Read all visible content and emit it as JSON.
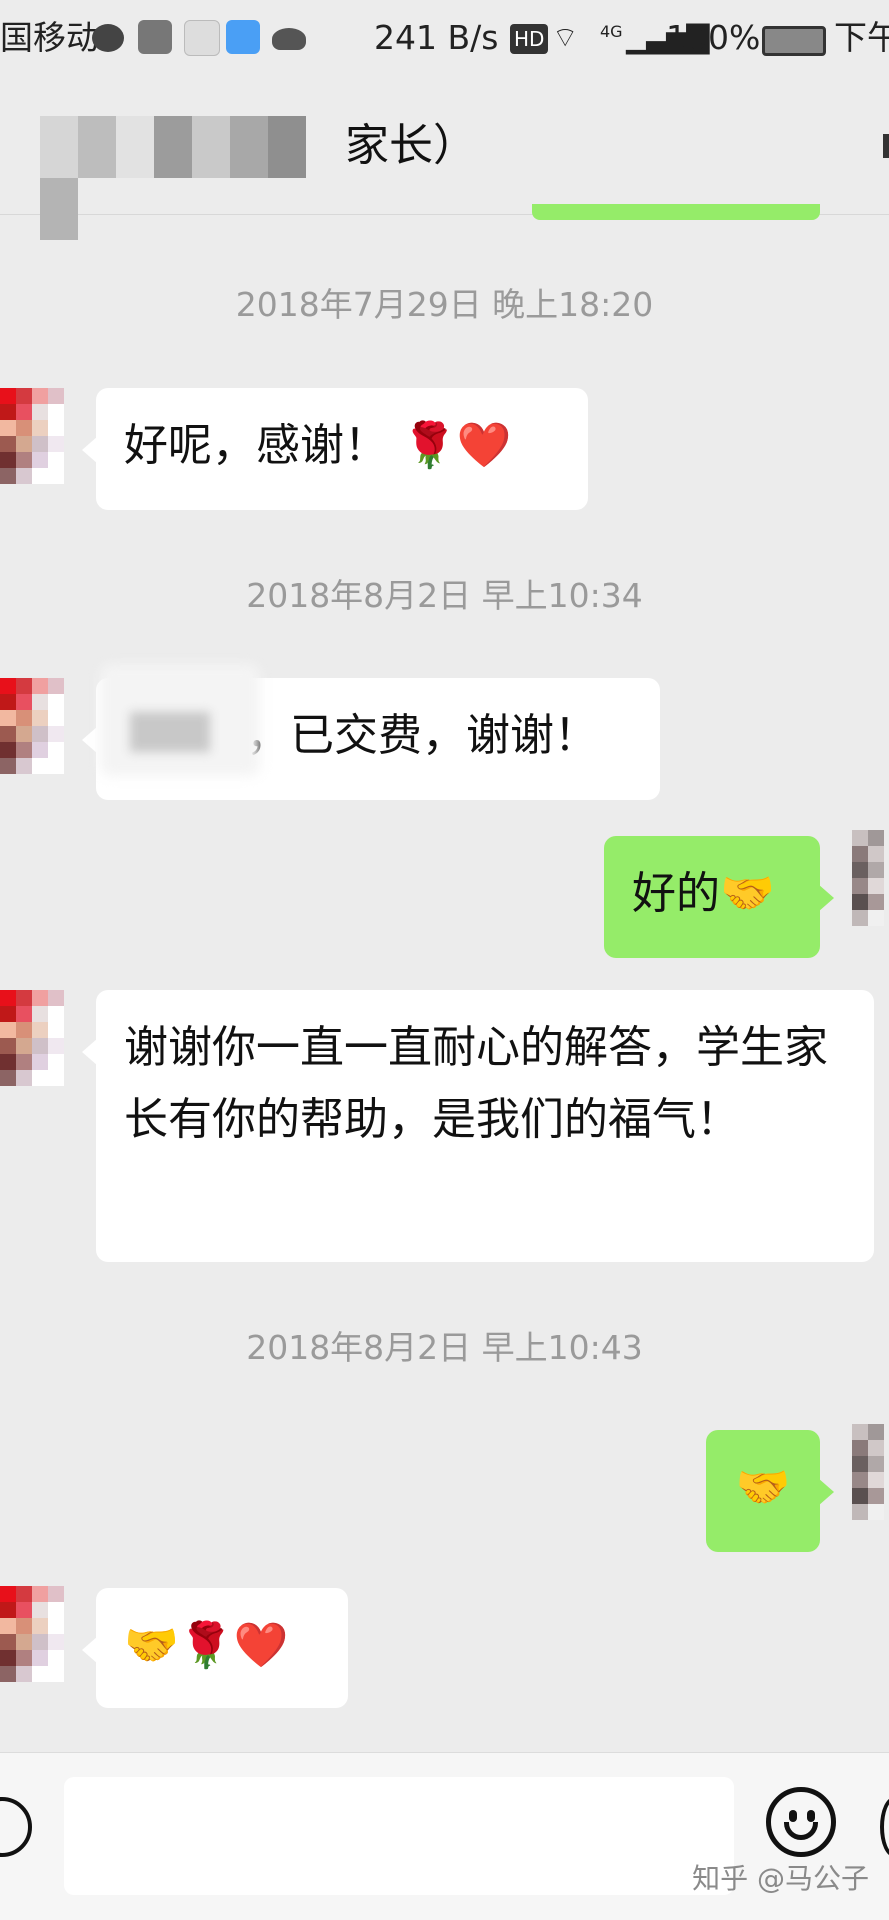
{
  "status_bar": {
    "carrier": "国移动",
    "speed": "241 B/s",
    "hd_badge": "HD",
    "network": "4G",
    "battery": "100%",
    "time_partial": "下午",
    "icons": [
      "wechat-icon",
      "tiktok-icon",
      "clock-app-icon",
      "blue-app-icon",
      "cloud-icon",
      "wifi-icon",
      "signal-icon",
      "battery-icon"
    ]
  },
  "header": {
    "title": "家长）"
  },
  "messages": [
    {
      "type": "timestamp",
      "text": "2018年7月29日 晚上18:20"
    },
    {
      "type": "received",
      "text": "好呢，感谢！",
      "emoji": "🌹❤️"
    },
    {
      "type": "timestamp",
      "text": "2018年8月2日 早上10:34"
    },
    {
      "type": "received",
      "text": "，已交费，谢谢！"
    },
    {
      "type": "sent",
      "text": "好的",
      "emoji": "🤝"
    },
    {
      "type": "received",
      "text": "谢谢你一直一直耐心的解答，学生家长有你的帮助，是我们的福气！"
    },
    {
      "type": "timestamp",
      "text": "2018年8月2日 早上10:43"
    },
    {
      "type": "sent",
      "emoji": "🤝"
    },
    {
      "type": "received",
      "emoji": "🤝🌹❤️"
    }
  ],
  "footer": {
    "watermark": "知乎 @马公子"
  }
}
